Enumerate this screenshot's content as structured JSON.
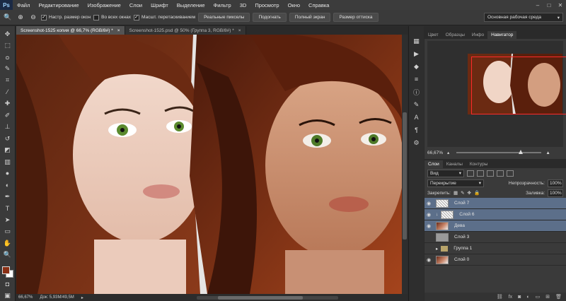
{
  "menubar": {
    "logo": "Ps",
    "items": [
      "Файл",
      "Редактирование",
      "Изображение",
      "Слои",
      "Шрифт",
      "Выделение",
      "Фильтр",
      "3D",
      "Просмотр",
      "Окно",
      "Справка"
    ],
    "controls": [
      "–",
      "□",
      "✕"
    ]
  },
  "options": {
    "resize_windows": "Настр. размер окон",
    "all_windows": "Во всех окнах",
    "scrubby_zoom": "Масшт. перетаскиванием",
    "btn_actual_pixels": "Реальные пикселы",
    "btn_fit": "Подогнать",
    "btn_fullscreen": "Полный экран",
    "btn_print_size": "Размер оттиска",
    "workspace": "Основная рабочая среда"
  },
  "documents": {
    "tabs": [
      {
        "title": "Screenshot-1525 копия @ 66,7% (RGB/8#) *",
        "close": "×"
      },
      {
        "title": "Screenshot-1525.psd @ 50% (Группа 3, RGB/8#) *",
        "close": "×"
      }
    ]
  },
  "status": {
    "zoom": "66,67%",
    "doc_size": "Док: 5,93M/49,5M"
  },
  "panels": {
    "top_tabs": [
      "Цвет",
      "Образцы",
      "Инфо",
      "Навигатор"
    ],
    "navigator_zoom": "66,67%",
    "layer_tabs": [
      "Слои",
      "Каналы",
      "Контуры"
    ],
    "filter_kind": "Вид",
    "blend_mode": "Перекрытие",
    "opacity_label": "Непрозрачность:",
    "opacity_value": "100%",
    "lock_label": "Закрепить:",
    "fill_label": "Заливка:",
    "fill_value": "100%",
    "layers": [
      {
        "name": "Слой 7",
        "thumb": "check",
        "selected": true,
        "eye": true
      },
      {
        "name": "Слой 6",
        "thumb": "check",
        "selected": true,
        "eye": true
      },
      {
        "name": "Дева",
        "thumb": "face",
        "selected": true,
        "eye": true
      },
      {
        "name": "Слой 3",
        "thumb": "gray",
        "selected": false,
        "eye": false
      },
      {
        "name": "Группа 1",
        "thumb": "folder",
        "selected": false,
        "eye": false
      },
      {
        "name": "Слой 0",
        "thumb": "face",
        "selected": false,
        "eye": true
      }
    ]
  },
  "icons": {
    "tools": [
      "move-icon",
      "marquee-icon",
      "lasso-icon",
      "quick-select-icon",
      "crop-icon",
      "eyedropper-icon",
      "healing-icon",
      "brush-icon",
      "stamp-icon",
      "history-brush-icon",
      "eraser-icon",
      "gradient-icon",
      "blur-icon",
      "dodge-icon",
      "pen-icon",
      "type-icon",
      "path-select-icon",
      "shape-icon",
      "hand-icon",
      "zoom-icon"
    ],
    "colors": {
      "foreground": "#8a2f14",
      "background": "#ffffff",
      "nav_frame": "#ff2a2a",
      "selection": "#5c6f8a"
    }
  }
}
